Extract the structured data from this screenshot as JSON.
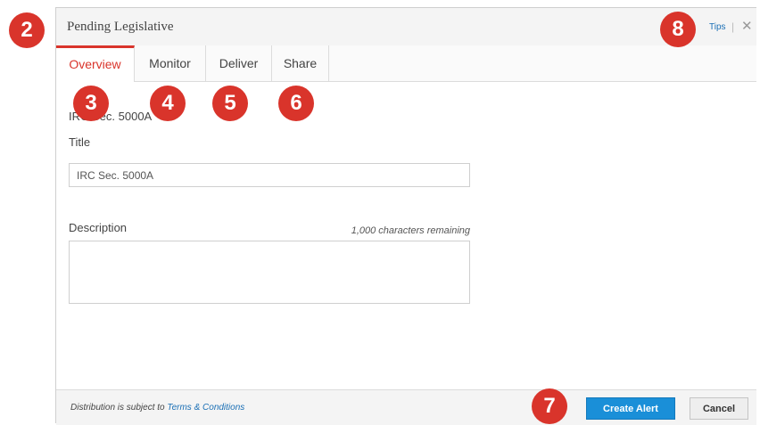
{
  "dialog": {
    "title": "Pending Legislative",
    "tips_label": "Tips",
    "separator": "|",
    "close_label": "✕"
  },
  "tabs": [
    {
      "label": "Overview",
      "active": true
    },
    {
      "label": "Monitor",
      "active": false
    },
    {
      "label": "Deliver",
      "active": false
    },
    {
      "label": "Share",
      "active": false
    }
  ],
  "overview": {
    "header_text": "IRC Sec. 5000A",
    "title_label": "Title",
    "title_value": "IRC Sec. 5000A",
    "description_label": "Description",
    "description_remaining": "1,000 characters remaining",
    "description_value": ""
  },
  "footer": {
    "distribution_text": "Distribution is subject to",
    "terms_link": "Terms & Conditions",
    "create_button": "Create Alert",
    "cancel_button": "Cancel"
  },
  "callouts": [
    "2",
    "3",
    "4",
    "5",
    "6",
    "7",
    "8"
  ],
  "colors": {
    "accent": "#d9342b",
    "primary_button": "#1a8fd8",
    "link": "#1a6fb5"
  }
}
